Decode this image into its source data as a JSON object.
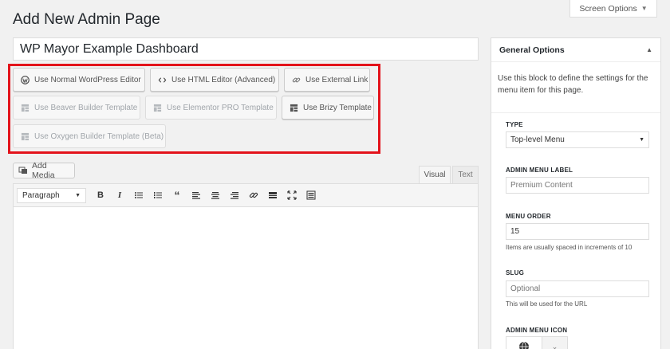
{
  "page": {
    "title": "Add New Admin Page",
    "screen_options_label": "Screen Options"
  },
  "title_input": {
    "value": "WP Mayor Example Dashboard"
  },
  "editor_buttons": [
    {
      "label": "Use Normal WordPress Editor",
      "icon": "wordpress-icon",
      "enabled": true
    },
    {
      "label": "Use HTML Editor (Advanced)",
      "icon": "code-icon",
      "enabled": true
    },
    {
      "label": "Use External Link",
      "icon": "link-icon",
      "enabled": true
    },
    {
      "label": "Use Beaver Builder Template",
      "icon": "template-icon",
      "enabled": false
    },
    {
      "label": "Use Elementor PRO Template",
      "icon": "template-icon",
      "enabled": false
    },
    {
      "label": "Use Brizy Template",
      "icon": "template-icon",
      "enabled": true
    },
    {
      "label": "Use Oxygen Builder Template (Beta)",
      "icon": "template-icon",
      "enabled": false
    }
  ],
  "editor": {
    "add_media_label": "Add Media",
    "tabs": [
      {
        "label": "Visual",
        "active": true
      },
      {
        "label": "Text",
        "active": false
      }
    ],
    "format_select": "Paragraph",
    "toolbar_icons": [
      "bold-icon",
      "italic-icon",
      "bullet-list-icon",
      "numbered-list-icon",
      "blockquote-icon",
      "align-left-icon",
      "align-center-icon",
      "align-right-icon",
      "insert-link-icon",
      "read-more-icon",
      "fullscreen-icon",
      "toolbar-toggle-icon"
    ]
  },
  "sidebar": {
    "title": "General Options",
    "description": "Use this block to define the settings for the menu item for this page.",
    "type_label": "TYPE",
    "type_value": "Top-level Menu",
    "menu_label_label": "ADMIN MENU LABEL",
    "menu_label_placeholder": "Premium Content",
    "menu_order_label": "MENU ORDER",
    "menu_order_value": "15",
    "menu_order_help": "Items are usually spaced in increments of 10",
    "slug_label": "SLUG",
    "slug_placeholder": "Optional",
    "slug_help": "This will be used for the URL",
    "icon_label": "ADMIN MENU ICON"
  },
  "colors": {
    "highlight": "#e3131b",
    "background": "#f1f1f1"
  }
}
